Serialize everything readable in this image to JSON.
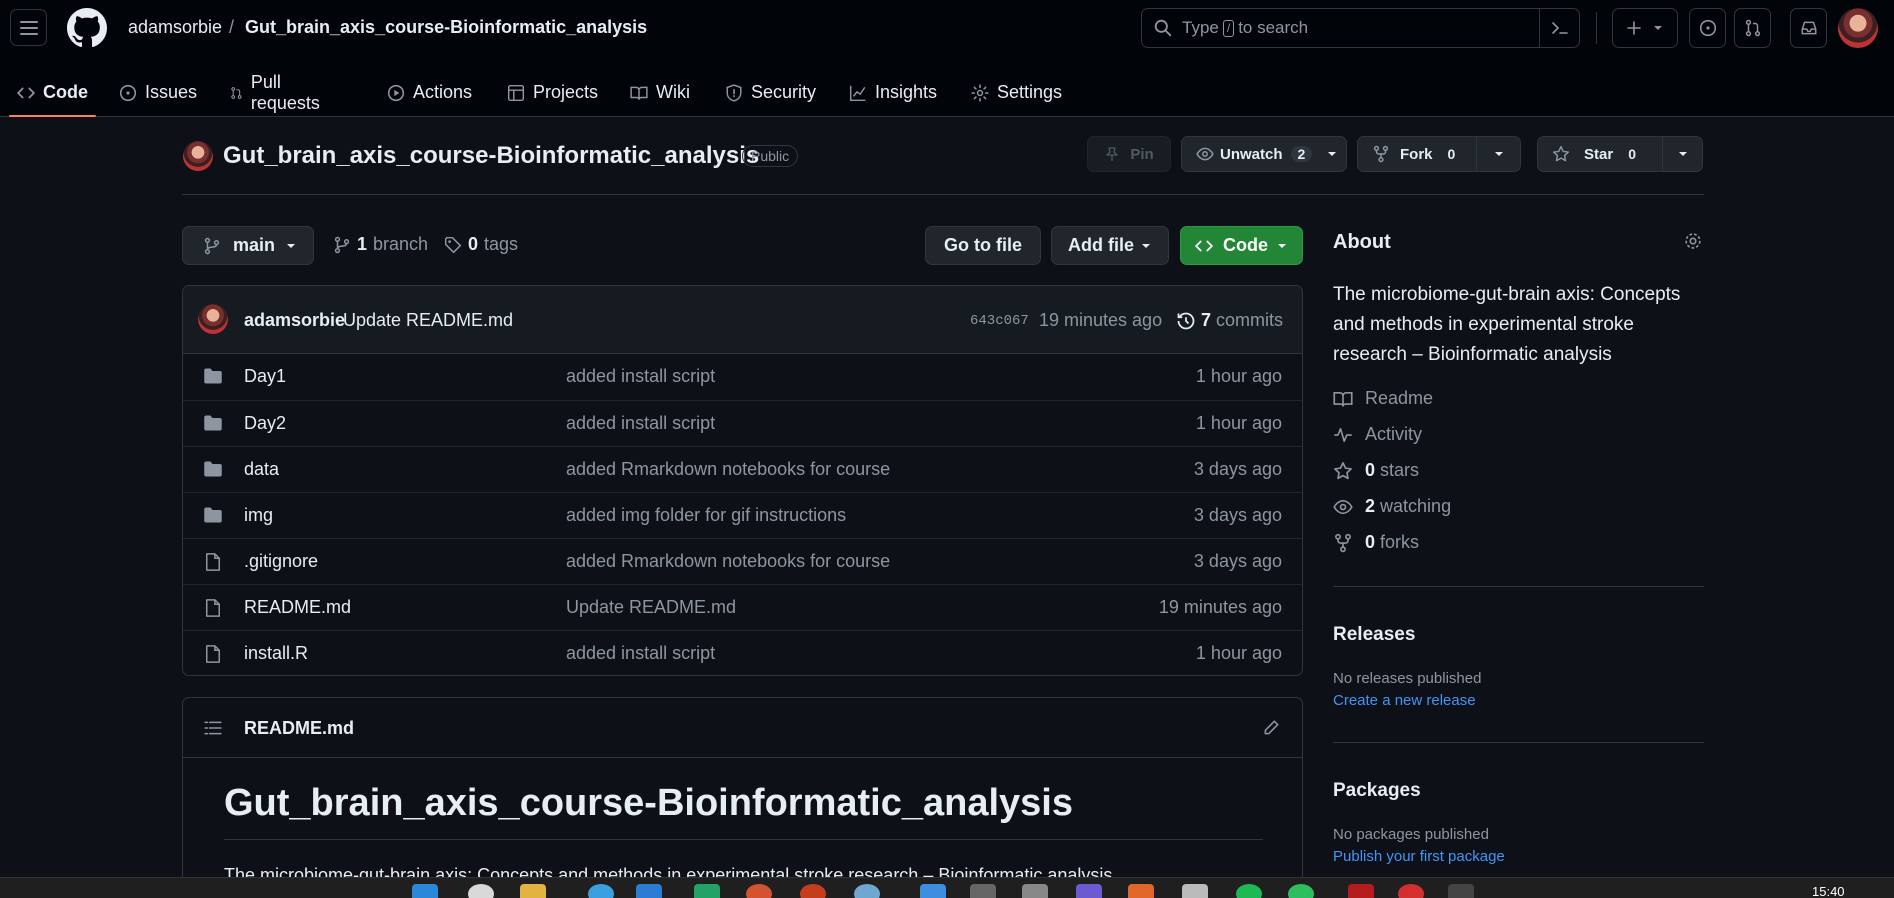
{
  "header": {
    "owner": "adamsorbie",
    "separator": "/",
    "repo": "Gut_brain_axis_course-Bioinformatic_analysis",
    "search_prefix": "Type",
    "search_key": "/",
    "search_suffix": "to search"
  },
  "tabs": [
    {
      "label": "Code",
      "icon": "code-icon"
    },
    {
      "label": "Issues",
      "icon": "issue-icon"
    },
    {
      "label": "Pull requests",
      "icon": "pull-request-icon"
    },
    {
      "label": "Actions",
      "icon": "play-icon"
    },
    {
      "label": "Projects",
      "icon": "table-icon"
    },
    {
      "label": "Wiki",
      "icon": "book-icon"
    },
    {
      "label": "Security",
      "icon": "shield-icon"
    },
    {
      "label": "Insights",
      "icon": "graph-icon"
    },
    {
      "label": "Settings",
      "icon": "gear-icon"
    }
  ],
  "repo_header": {
    "title": "Gut_brain_axis_course-Bioinformatic_analysis",
    "visibility": "Public",
    "pin_label": "Pin",
    "unwatch_label": "Unwatch",
    "watch_count": "2",
    "fork_label": "Fork",
    "fork_count": "0",
    "star_label": "Star",
    "star_count": "0"
  },
  "branch_bar": {
    "branch": "main",
    "branch_count": "1",
    "branch_word": "branch",
    "tag_count": "0",
    "tag_word": "tags",
    "go_to_file": "Go to file",
    "add_file": "Add file",
    "code": "Code"
  },
  "latest_commit": {
    "author": "adamsorbie",
    "message": "Update README.md",
    "sha": "643c067",
    "time": "19 minutes ago",
    "commit_count": "7",
    "commit_word": "commits"
  },
  "files": [
    {
      "name": "Day1",
      "type": "folder",
      "message": "added install script",
      "time": "1 hour ago"
    },
    {
      "name": "Day2",
      "type": "folder",
      "message": "added install script",
      "time": "1 hour ago"
    },
    {
      "name": "data",
      "type": "folder",
      "message": "added Rmarkdown notebooks for course",
      "time": "3 days ago"
    },
    {
      "name": "img",
      "type": "folder",
      "message": "added img folder for gif instructions",
      "time": "3 days ago"
    },
    {
      "name": ".gitignore",
      "type": "file",
      "message": "added Rmarkdown notebooks for course",
      "time": "3 days ago"
    },
    {
      "name": "README.md",
      "type": "file",
      "message": "Update README.md",
      "time": "19 minutes ago"
    },
    {
      "name": "install.R",
      "type": "file",
      "message": "added install script",
      "time": "1 hour ago"
    }
  ],
  "readme": {
    "filename": "README.md",
    "heading": "Gut_brain_axis_course-Bioinformatic_analysis",
    "first_line": "The microbiome-gut-brain axis: Concepts and methods in experimental stroke research – Bioinformatic analysis"
  },
  "about": {
    "title": "About",
    "description_1": "The microbiome-gut-brain axis: Concepts",
    "description_2": "and methods in experimental stroke",
    "description_3": "research – Bioinformatic analysis",
    "readme": "Readme",
    "activity": "Activity",
    "stars_count": "0",
    "stars_word": "stars",
    "watching_count": "2",
    "watching_word": "watching",
    "forks_count": "0",
    "forks_word": "forks"
  },
  "releases": {
    "title": "Releases",
    "empty": "No releases published",
    "create_link": "Create a new release"
  },
  "packages": {
    "title": "Packages",
    "empty": "No packages published",
    "publish_link": "Publish your first package"
  },
  "taskbar": {
    "clock": "15:40"
  },
  "colors": {
    "background": "#0d1117",
    "accent_underline": "#f78166",
    "code_button": "#238636",
    "link": "#4493f8"
  }
}
